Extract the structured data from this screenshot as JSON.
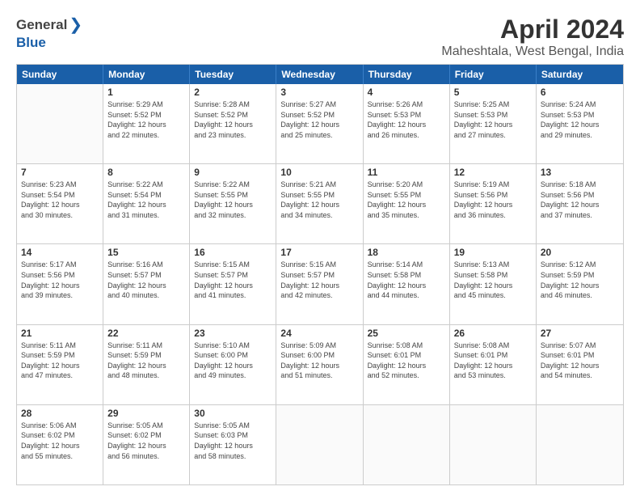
{
  "header": {
    "logo_general": "General",
    "logo_blue": "Blue",
    "title": "April 2024",
    "subtitle": "Maheshtala, West Bengal, India"
  },
  "days": [
    "Sunday",
    "Monday",
    "Tuesday",
    "Wednesday",
    "Thursday",
    "Friday",
    "Saturday"
  ],
  "weeks": [
    [
      {
        "date": "",
        "info": ""
      },
      {
        "date": "1",
        "info": "Sunrise: 5:29 AM\nSunset: 5:52 PM\nDaylight: 12 hours\nand 22 minutes."
      },
      {
        "date": "2",
        "info": "Sunrise: 5:28 AM\nSunset: 5:52 PM\nDaylight: 12 hours\nand 23 minutes."
      },
      {
        "date": "3",
        "info": "Sunrise: 5:27 AM\nSunset: 5:52 PM\nDaylight: 12 hours\nand 25 minutes."
      },
      {
        "date": "4",
        "info": "Sunrise: 5:26 AM\nSunset: 5:53 PM\nDaylight: 12 hours\nand 26 minutes."
      },
      {
        "date": "5",
        "info": "Sunrise: 5:25 AM\nSunset: 5:53 PM\nDaylight: 12 hours\nand 27 minutes."
      },
      {
        "date": "6",
        "info": "Sunrise: 5:24 AM\nSunset: 5:53 PM\nDaylight: 12 hours\nand 29 minutes."
      }
    ],
    [
      {
        "date": "7",
        "info": "Sunrise: 5:23 AM\nSunset: 5:54 PM\nDaylight: 12 hours\nand 30 minutes."
      },
      {
        "date": "8",
        "info": "Sunrise: 5:22 AM\nSunset: 5:54 PM\nDaylight: 12 hours\nand 31 minutes."
      },
      {
        "date": "9",
        "info": "Sunrise: 5:22 AM\nSunset: 5:55 PM\nDaylight: 12 hours\nand 32 minutes."
      },
      {
        "date": "10",
        "info": "Sunrise: 5:21 AM\nSunset: 5:55 PM\nDaylight: 12 hours\nand 34 minutes."
      },
      {
        "date": "11",
        "info": "Sunrise: 5:20 AM\nSunset: 5:55 PM\nDaylight: 12 hours\nand 35 minutes."
      },
      {
        "date": "12",
        "info": "Sunrise: 5:19 AM\nSunset: 5:56 PM\nDaylight: 12 hours\nand 36 minutes."
      },
      {
        "date": "13",
        "info": "Sunrise: 5:18 AM\nSunset: 5:56 PM\nDaylight: 12 hours\nand 37 minutes."
      }
    ],
    [
      {
        "date": "14",
        "info": "Sunrise: 5:17 AM\nSunset: 5:56 PM\nDaylight: 12 hours\nand 39 minutes."
      },
      {
        "date": "15",
        "info": "Sunrise: 5:16 AM\nSunset: 5:57 PM\nDaylight: 12 hours\nand 40 minutes."
      },
      {
        "date": "16",
        "info": "Sunrise: 5:15 AM\nSunset: 5:57 PM\nDaylight: 12 hours\nand 41 minutes."
      },
      {
        "date": "17",
        "info": "Sunrise: 5:15 AM\nSunset: 5:57 PM\nDaylight: 12 hours\nand 42 minutes."
      },
      {
        "date": "18",
        "info": "Sunrise: 5:14 AM\nSunset: 5:58 PM\nDaylight: 12 hours\nand 44 minutes."
      },
      {
        "date": "19",
        "info": "Sunrise: 5:13 AM\nSunset: 5:58 PM\nDaylight: 12 hours\nand 45 minutes."
      },
      {
        "date": "20",
        "info": "Sunrise: 5:12 AM\nSunset: 5:59 PM\nDaylight: 12 hours\nand 46 minutes."
      }
    ],
    [
      {
        "date": "21",
        "info": "Sunrise: 5:11 AM\nSunset: 5:59 PM\nDaylight: 12 hours\nand 47 minutes."
      },
      {
        "date": "22",
        "info": "Sunrise: 5:11 AM\nSunset: 5:59 PM\nDaylight: 12 hours\nand 48 minutes."
      },
      {
        "date": "23",
        "info": "Sunrise: 5:10 AM\nSunset: 6:00 PM\nDaylight: 12 hours\nand 49 minutes."
      },
      {
        "date": "24",
        "info": "Sunrise: 5:09 AM\nSunset: 6:00 PM\nDaylight: 12 hours\nand 51 minutes."
      },
      {
        "date": "25",
        "info": "Sunrise: 5:08 AM\nSunset: 6:01 PM\nDaylight: 12 hours\nand 52 minutes."
      },
      {
        "date": "26",
        "info": "Sunrise: 5:08 AM\nSunset: 6:01 PM\nDaylight: 12 hours\nand 53 minutes."
      },
      {
        "date": "27",
        "info": "Sunrise: 5:07 AM\nSunset: 6:01 PM\nDaylight: 12 hours\nand 54 minutes."
      }
    ],
    [
      {
        "date": "28",
        "info": "Sunrise: 5:06 AM\nSunset: 6:02 PM\nDaylight: 12 hours\nand 55 minutes."
      },
      {
        "date": "29",
        "info": "Sunrise: 5:05 AM\nSunset: 6:02 PM\nDaylight: 12 hours\nand 56 minutes."
      },
      {
        "date": "30",
        "info": "Sunrise: 5:05 AM\nSunset: 6:03 PM\nDaylight: 12 hours\nand 58 minutes."
      },
      {
        "date": "",
        "info": ""
      },
      {
        "date": "",
        "info": ""
      },
      {
        "date": "",
        "info": ""
      },
      {
        "date": "",
        "info": ""
      }
    ]
  ]
}
